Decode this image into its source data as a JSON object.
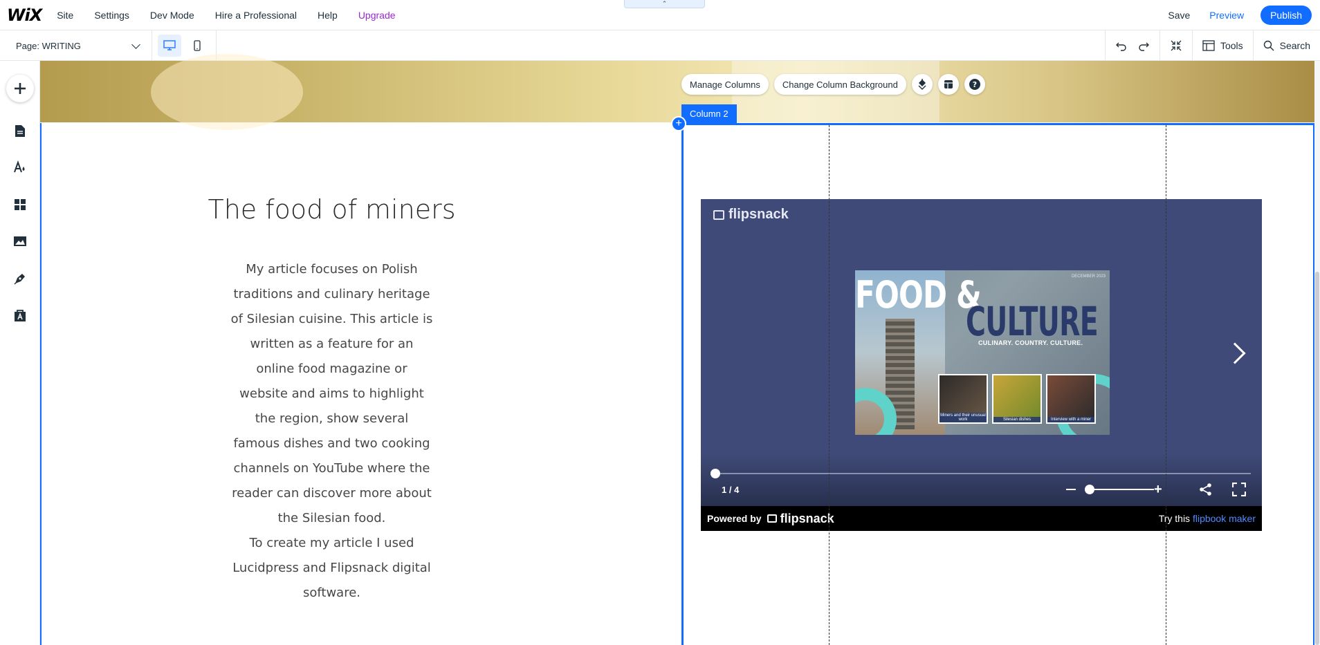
{
  "app": {
    "logo": "WiX"
  },
  "topmenu": {
    "items": [
      "Site",
      "Settings",
      "Dev Mode",
      "Hire a Professional",
      "Help",
      "Upgrade"
    ],
    "save_label": "Save",
    "preview_label": "Preview",
    "publish_label": "Publish",
    "collapse_glyph": "⌃"
  },
  "toolbar": {
    "page_label": "Page: WRITING",
    "tools_label": "Tools",
    "search_label": "Search"
  },
  "sidebar": {
    "icons": [
      "add-icon",
      "pages-icon",
      "design-icon",
      "apps-icon",
      "media-icon",
      "blog-icon",
      "business-icon"
    ]
  },
  "column": {
    "manage_label": "Manage Columns",
    "background_label": "Change Column Background",
    "tag_label": "Column 2",
    "add_glyph": "+"
  },
  "article": {
    "heading": "The food of miners",
    "paragraph1": "My article focuses on Polish traditions and culinary heritage of Silesian cuisine. This article is written as a feature for an online food magazine or website and aims to highlight the region, show several famous dishes and two cooking channels on YouTube where the reader can discover more about the Silesian food.",
    "paragraph2": "To create my article I used Lucidpress and Flipsnack digital software."
  },
  "flipbook": {
    "brand": "flipsnack",
    "cover_title_1": "FOOD &",
    "cover_title_2": "CULTURE",
    "cover_subtitle": "CULINARY. COUNTRY. CULTURE.",
    "cover_date": "DECEMBER 2023",
    "thumbs": [
      "Miners and their unusual work",
      "Silesian dishes",
      "Interview with a miner"
    ],
    "page_indicator": "1 / 4",
    "progress": 0,
    "zoom_level": 0,
    "powered_by": "Powered by",
    "try_prefix": "Try this",
    "try_link": "flipbook maker"
  },
  "colors": {
    "accent": "#116dff",
    "upgrade": "#9a27d5",
    "flip_bg": "#3f4a78"
  }
}
